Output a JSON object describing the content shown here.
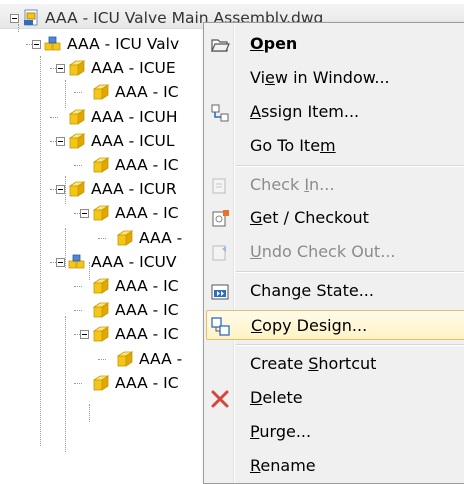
{
  "tree": {
    "root": {
      "label": "AAA - ICU Valve Main Assembly.dwg"
    },
    "nodes": [
      {
        "label": "AAA - ICU Valv",
        "type": "assembly",
        "expander": true
      },
      {
        "label": "AAA - ICUE",
        "type": "part",
        "expander": true
      },
      {
        "label": "AAA - IC",
        "type": "part",
        "expander": false
      },
      {
        "label": "AAA - ICUH",
        "type": "part",
        "expander": false
      },
      {
        "label": "AAA - ICUL",
        "type": "part",
        "expander": true
      },
      {
        "label": "AAA - IC",
        "type": "part",
        "expander": false
      },
      {
        "label": "AAA - ICUR",
        "type": "part",
        "expander": true
      },
      {
        "label": "AAA - IC",
        "type": "part",
        "expander": true
      },
      {
        "label": "AAA -",
        "type": "part",
        "expander": false
      },
      {
        "label": "AAA - ICUV",
        "type": "assembly",
        "expander": true
      },
      {
        "label": "AAA - IC",
        "type": "part",
        "expander": false
      },
      {
        "label": "AAA - IC",
        "type": "part",
        "expander": false
      },
      {
        "label": "AAA - IC",
        "type": "part",
        "expander": true
      },
      {
        "label": "AAA -",
        "type": "part",
        "expander": false
      },
      {
        "label": "AAA - IC",
        "type": "part",
        "expander": false
      }
    ]
  },
  "menu": {
    "items": [
      {
        "pre": "",
        "u": "O",
        "post": "pen",
        "icon": "open-folder-icon",
        "disabled": false,
        "bold": true
      },
      {
        "pre": "Vi",
        "u": "e",
        "post": "w in Window...",
        "icon": "",
        "disabled": false,
        "bold": false
      },
      {
        "pre": "",
        "u": "A",
        "post": "ssign Item...",
        "icon": "assign-item-icon",
        "disabled": false,
        "bold": false
      },
      {
        "pre": "Go To Ite",
        "u": "m",
        "post": "",
        "icon": "",
        "disabled": false,
        "bold": false
      },
      {
        "pre": "Check ",
        "u": "I",
        "post": "n...",
        "icon": "check-in-icon",
        "disabled": true,
        "bold": false
      },
      {
        "pre": "",
        "u": "G",
        "post": "et / Checkout",
        "icon": "get-checkout-icon",
        "disabled": false,
        "bold": false
      },
      {
        "pre": "",
        "u": "U",
        "post": "ndo Check Out...",
        "icon": "undo-checkout-icon",
        "disabled": true,
        "bold": false
      },
      {
        "pre": "Chan",
        "u": "g",
        "post": "e State...",
        "icon": "change-state-icon",
        "disabled": false,
        "bold": false
      },
      {
        "pre": "",
        "u": "C",
        "post": "opy Design...",
        "icon": "copy-design-icon",
        "disabled": false,
        "bold": false
      },
      {
        "pre": "Create ",
        "u": "S",
        "post": "hortcut",
        "icon": "",
        "disabled": false,
        "bold": false
      },
      {
        "pre": "",
        "u": "D",
        "post": "elete",
        "icon": "delete-icon",
        "disabled": false,
        "bold": false
      },
      {
        "pre": "",
        "u": "P",
        "post": "urge...",
        "icon": "",
        "disabled": false,
        "bold": false
      },
      {
        "pre": "",
        "u": "R",
        "post": "ename",
        "icon": "",
        "disabled": false,
        "bold": false
      }
    ],
    "hovered_index": 8,
    "colors": {
      "hover_border": "#e4c168",
      "disabled_text": "#8b8b8b",
      "delete_red": "#d9443a",
      "part_yellow": "#f5c518"
    }
  }
}
